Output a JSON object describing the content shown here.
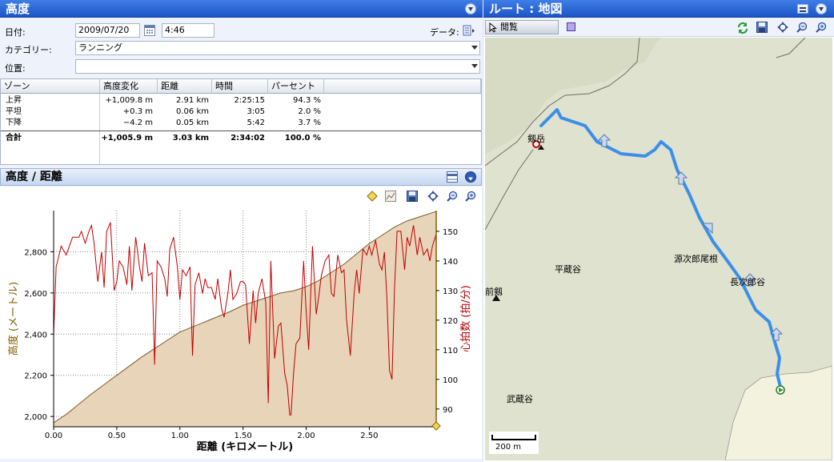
{
  "left_title": "高度",
  "right_title": "ルート : 地図",
  "form": {
    "date_label": "日付:",
    "date_value": "2009/07/20",
    "time_value": "4:46",
    "data_label": "データ:",
    "category_label": "カテゴリー:",
    "category_value": "ランニング",
    "location_label": "位置:",
    "location_value": ""
  },
  "table": {
    "headers": [
      "ゾーン",
      "高度変化",
      "距離",
      "時間",
      "パーセント"
    ],
    "rows": [
      {
        "zone": "上昇",
        "change": "+1,009.8  m",
        "dist": "2.91  km",
        "time": "2:25:15",
        "pct": "94.3  %"
      },
      {
        "zone": "平坦",
        "change": "+0.3  m",
        "dist": "0.06  km",
        "time": "3:05",
        "pct": "2.0  %"
      },
      {
        "zone": "下降",
        "change": "−4.2  m",
        "dist": "0.05  km",
        "time": "5:42",
        "pct": "3.7  %"
      },
      {
        "zone": "合計",
        "change": "+1,005.9  m",
        "dist": "3.03  km",
        "time": "2:34:02",
        "pct": "100.0  %"
      }
    ]
  },
  "chart_panel_title": "高度 / 距離",
  "map": {
    "mode_button": "閲覧",
    "labels": {
      "tsurugidake": "剱岳",
      "heizoudani": "平蔵谷",
      "genjirou": "源次郎尾根",
      "choujirou": "長次郎谷",
      "maetsurugi": "前剱",
      "musashidani": "武蔵谷"
    },
    "scale_label": "200 m"
  },
  "colors": {
    "elevation_fill": "#e8d4b8",
    "elevation_line": "#7a5a2a",
    "hr_line": "#c00000",
    "route": "#3b8fe8",
    "left_axis": "#806000",
    "right_axis": "#b00000"
  },
  "chart_data": {
    "type": "line",
    "xlabel": "距離 (キロメートル)",
    "ylabel_left": "高度 (メートル)",
    "ylabel_right": "心拍数 (拍/分)",
    "xlim": [
      0,
      3.03
    ],
    "ylim_left": [
      1950,
      3000
    ],
    "ylim_right": [
      84,
      157
    ],
    "x_ticks": [
      "0.00",
      "0.50",
      "1.00",
      "1.50",
      "2.00",
      "2.50"
    ],
    "y_left_ticks": [
      "2,000",
      "2,200",
      "2,400",
      "2,600",
      "2,800"
    ],
    "y_right_ticks": [
      "90",
      "100",
      "110",
      "120",
      "130",
      "140",
      "150"
    ],
    "series": [
      {
        "name": "高度",
        "axis": "left",
        "x": [
          0,
          0.1,
          0.3,
          0.5,
          0.7,
          0.9,
          1.0,
          1.2,
          1.4,
          1.5,
          1.7,
          1.8,
          1.9,
          2.0,
          2.1,
          2.2,
          2.3,
          2.4,
          2.5,
          2.6,
          2.7,
          2.8,
          2.9,
          3.0,
          3.03
        ],
        "values": [
          1970,
          2010,
          2110,
          2200,
          2290,
          2370,
          2410,
          2460,
          2510,
          2540,
          2580,
          2600,
          2610,
          2630,
          2660,
          2700,
          2740,
          2790,
          2840,
          2880,
          2920,
          2950,
          2970,
          2990,
          2995
        ]
      },
      {
        "name": "心拍数",
        "axis": "right",
        "x": [
          0,
          0.02,
          0.06,
          0.1,
          0.15,
          0.2,
          0.22,
          0.25,
          0.28,
          0.3,
          0.32,
          0.35,
          0.38,
          0.4,
          0.42,
          0.45,
          0.48,
          0.5,
          0.52,
          0.55,
          0.58,
          0.6,
          0.62,
          0.65,
          0.68,
          0.7,
          0.72,
          0.75,
          0.78,
          0.8,
          0.82,
          0.85,
          0.88,
          0.9,
          0.92,
          0.95,
          0.98,
          1.0,
          1.02,
          1.05,
          1.08,
          1.1,
          1.12,
          1.15,
          1.18,
          1.2,
          1.22,
          1.25,
          1.28,
          1.3,
          1.33,
          1.35,
          1.38,
          1.4,
          1.42,
          1.45,
          1.48,
          1.5,
          1.52,
          1.55,
          1.58,
          1.6,
          1.62,
          1.65,
          1.68,
          1.7,
          1.72,
          1.75,
          1.78,
          1.8,
          1.83,
          1.85,
          1.87,
          1.88,
          1.9,
          1.92,
          1.95,
          1.98,
          2.0,
          2.02,
          2.05,
          2.08,
          2.1,
          2.12,
          2.15,
          2.18,
          2.2,
          2.22,
          2.25,
          2.28,
          2.3,
          2.32,
          2.35,
          2.38,
          2.4,
          2.42,
          2.45,
          2.48,
          2.5,
          2.52,
          2.55,
          2.58,
          2.6,
          2.62,
          2.64,
          2.66,
          2.68,
          2.7,
          2.72,
          2.75,
          2.78,
          2.8,
          2.82,
          2.85,
          2.88,
          2.9,
          2.93,
          2.96,
          2.98,
          3.0,
          3.03
        ],
        "values": [
          115,
          138,
          145,
          142,
          148,
          148,
          150,
          146,
          150,
          152,
          146,
          133,
          143,
          131,
          150,
          153,
          130,
          133,
          140,
          138,
          132,
          145,
          130,
          148,
          138,
          133,
          146,
          135,
          136,
          105,
          140,
          138,
          134,
          128,
          144,
          148,
          138,
          127,
          137,
          135,
          138,
          108,
          132,
          136,
          129,
          134,
          131,
          131,
          127,
          134,
          124,
          121,
          129,
          137,
          127,
          129,
          133,
          133,
          132,
          112,
          130,
          119,
          129,
          134,
          126,
          92,
          140,
          107,
          118,
          119,
          102,
          98,
          88,
          88,
          102,
          112,
          114,
          140,
          123,
          110,
          145,
          122,
          128,
          135,
          140,
          142,
          129,
          128,
          142,
          136,
          137,
          120,
          108,
          129,
          137,
          129,
          144,
          142,
          145,
          142,
          147,
          139,
          137,
          143,
          127,
          103,
          100,
          131,
          150,
          150,
          137,
          148,
          145,
          152,
          142,
          148,
          142,
          144,
          140,
          145,
          149
        ]
      }
    ]
  }
}
